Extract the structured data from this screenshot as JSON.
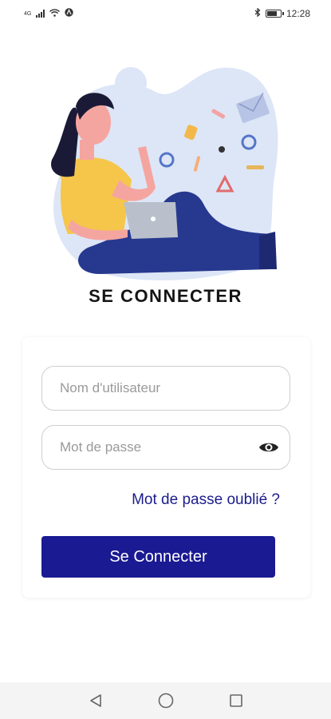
{
  "status_bar": {
    "network_label": "4G",
    "time": "12:28",
    "battery_level": 0.8,
    "icons": [
      "signal-icon",
      "wifi-icon",
      "app-notification-icon",
      "bluetooth-icon",
      "battery-icon"
    ]
  },
  "illustration": {
    "description_icon": "woman-with-laptop-illustration"
  },
  "login": {
    "title": "SE CONNECTER",
    "username_placeholder": "Nom d'utilisateur",
    "username_value": "",
    "password_placeholder": "Mot de passe",
    "password_value": "",
    "forgot_password": "Mot de passe oublié ?",
    "submit_label": "Se Connecter"
  },
  "nav_bar": {
    "icons": [
      "back-icon",
      "home-icon",
      "recents-icon"
    ]
  },
  "colors": {
    "primary": "#1a1a93",
    "link": "#1c1c8c",
    "blob": "#dde6f6",
    "trousers": "#27388f",
    "shirt": "#f5c64a"
  }
}
